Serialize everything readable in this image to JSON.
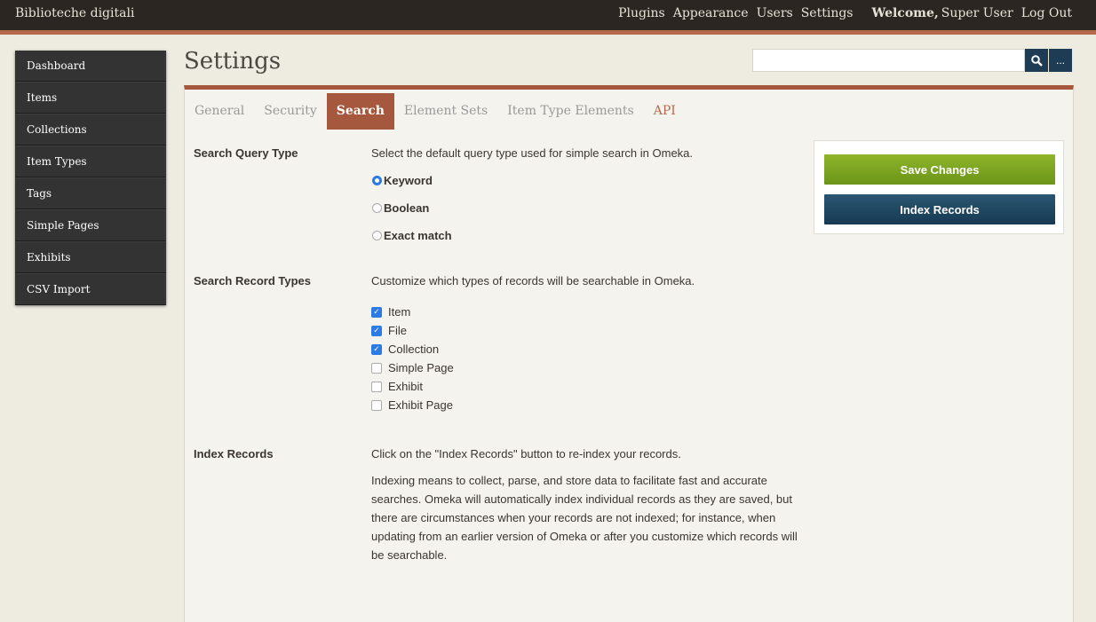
{
  "header": {
    "site_title": "Biblioteche digitali",
    "nav": [
      "Plugins",
      "Appearance",
      "Users",
      "Settings"
    ],
    "welcome": "Welcome,",
    "user": "Super User",
    "logout": "Log Out"
  },
  "sidebar": {
    "items": [
      "Dashboard",
      "Items",
      "Collections",
      "Item Types",
      "Tags",
      "Simple Pages",
      "Exhibits",
      "CSV Import"
    ]
  },
  "page": {
    "title": "Settings",
    "search_placeholder": "",
    "search_icon": "search-icon",
    "advanced_label": "..."
  },
  "tabs": [
    "General",
    "Security",
    "Search",
    "Element Sets",
    "Item Type Elements",
    "API"
  ],
  "active_tab": "Search",
  "query_type": {
    "label": "Search Query Type",
    "desc": "Select the default query type used for simple search in Omeka.",
    "options": [
      "Keyword",
      "Boolean",
      "Exact match"
    ],
    "selected": "Keyword"
  },
  "record_types": {
    "label": "Search Record Types",
    "desc": "Customize which types of records will be searchable in Omeka.",
    "options": [
      {
        "label": "Item",
        "checked": true
      },
      {
        "label": "File",
        "checked": true
      },
      {
        "label": "Collection",
        "checked": true
      },
      {
        "label": "Simple Page",
        "checked": false
      },
      {
        "label": "Exhibit",
        "checked": false
      },
      {
        "label": "Exhibit Page",
        "checked": false
      }
    ]
  },
  "index": {
    "label": "Index Records",
    "desc": "Click on the \"Index Records\" button to re-index your records.",
    "para": "Indexing means to collect, parse, and store data to facilitate fast and accurate searches. Omeka will automatically index individual records as they are saved, but there are circumstances when your records are not indexed; for instance, when updating from an earlier version of Omeka or after you customize which records will be searchable."
  },
  "actions": {
    "save": "Save Changes",
    "index": "Index Records"
  },
  "colors": {
    "accent": "#a5583d",
    "save": "#7ea321",
    "index": "#1f4862",
    "check": "#2a7be4"
  }
}
